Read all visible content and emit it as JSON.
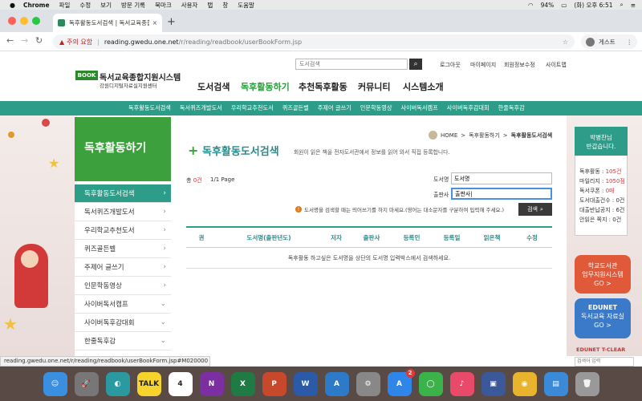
{
  "menubar": {
    "app": "Chrome",
    "items": [
      "파일",
      "수정",
      "보기",
      "방문 기록",
      "북마크",
      "사용자",
      "탭",
      "창",
      "도움말"
    ],
    "battery": "94%",
    "clock": "(화) 오후 6:51"
  },
  "tab": {
    "title": "독후활동도서검색 | 독서교육종합지원시스템",
    "close": "×"
  },
  "newtab": "+",
  "address": {
    "security": "주의 요함",
    "host": "reading.gwedu.one.net",
    "path": "/r/reading/readbook/userBookForm.jsp",
    "guest": "게스트"
  },
  "site": {
    "logo_badge": "BOOK",
    "logo_title": "독서교육종합지원시스템",
    "logo_sub": "강원디지털자료실지원센터",
    "search_placeholder": "도서검색",
    "util": [
      "로그아웃",
      "마이페이지",
      "회원정보수정",
      "사이트맵"
    ],
    "gnav": [
      "도서검색",
      "독후활동하기",
      "추천독후활동",
      "커뮤니티",
      "시스템소개"
    ],
    "subnav": [
      "독후활동도서검색",
      "독서퀴즈개발도서",
      "우리학교추천도서",
      "퀴즈골든벨",
      "주제어 글쓰기",
      "인문학동영상",
      "사이버독서캠프",
      "사이버독후감대회",
      "한줄독후감"
    ]
  },
  "side": {
    "title": "독후활동하기",
    "items": [
      "독후활동도서검색",
      "독서퀴즈개발도서",
      "우리학교추천도서",
      "퀴즈골든벨",
      "주제어 글쓰기",
      "인문학동영상",
      "사이버독서캠프",
      "사이버독후감대회",
      "한줄독후감"
    ]
  },
  "content": {
    "breadcrumb": [
      "HOME",
      ">",
      "독후활동하기",
      ">",
      "독후활동도서검색"
    ],
    "plus": "+",
    "title": "독후활동도서검색",
    "desc": "회원이 읽은 책을 전자도서관에서 정보를 읽어 와서 직접 등록합니다.",
    "count_label": "총",
    "count_value": "0건",
    "page": "1/1 Page",
    "book_label": "도서명",
    "book_value": "도서명",
    "pub_label": "출판사",
    "pub_value": "출판사|",
    "warning": "도서명을 검색할 때는 띄어쓰기를 하지 마세요.(영어는 대소문자를 구분하여 입력해 주세요.)",
    "search_btn": "검색",
    "columns": [
      "권",
      "도서명(출판년도)",
      "저자",
      "출판사",
      "등록인",
      "등록일",
      "읽은책",
      "수정"
    ],
    "empty_msg": "독후활동 하고싶은 도서명을 상단의 도서명 입력박스에서 검색하세요."
  },
  "user": {
    "greeting1": "박병찬님",
    "greeting2": "반갑습니다.",
    "stats": [
      {
        "label": "독후활동 : ",
        "value": "105건"
      },
      {
        "label": "마일리지 : ",
        "value": "1050점"
      },
      {
        "label": "독서쿠폰 : ",
        "value": "0매"
      },
      {
        "label": "도서대출건수 : ",
        "value": "0건"
      },
      {
        "label": "대출반납공지 : ",
        "value": "6건"
      },
      {
        "label": "안읽은 쪽지 : ",
        "value": "0건"
      }
    ]
  },
  "right": {
    "btn_a1": "학교도서관",
    "btn_a2": "업무지원시스템",
    "btn_a3": "GO >",
    "btn_b1": "EDUNET",
    "btn_b2": "독서교육 자료실",
    "btn_b3": "GO >",
    "edunet": "EDUNET T-CLEAR",
    "search_placeholder": "검색어 입력"
  },
  "status_url": "reading.gwedu.one.net/r/reading/readbook/userBookForm.jsp#M020000",
  "dock": [
    {
      "name": "finder",
      "color": "#3b8fe0",
      "label": "☺"
    },
    {
      "name": "launchpad",
      "color": "#777",
      "label": "🚀"
    },
    {
      "name": "safari-like",
      "color": "#2a9aa0",
      "label": "◐"
    },
    {
      "name": "kakaotalk",
      "color": "#f6d32d",
      "label": "TALK"
    },
    {
      "name": "calendar",
      "color": "#fff",
      "label": "4"
    },
    {
      "name": "onenote",
      "color": "#7b2fa0",
      "label": "N"
    },
    {
      "name": "excel",
      "color": "#1f7a44",
      "label": "X"
    },
    {
      "name": "powerpoint",
      "color": "#c8482b",
      "label": "P"
    },
    {
      "name": "word",
      "color": "#2b5ba8",
      "label": "W"
    },
    {
      "name": "dictionary",
      "color": "#2c7ac8",
      "label": "A"
    },
    {
      "name": "system-prefs",
      "color": "#888",
      "label": "⚙"
    },
    {
      "name": "app-store",
      "color": "#2d86e8",
      "label": "A"
    },
    {
      "name": "whatsapp",
      "color": "#3ab34a",
      "label": "◯"
    },
    {
      "name": "music",
      "color": "#e94a6a",
      "label": "♪"
    },
    {
      "name": "virtualbox",
      "color": "#3b5998",
      "label": "▣"
    },
    {
      "name": "chrome",
      "color": "#e8b32d",
      "label": "◉"
    },
    {
      "name": "docs",
      "color": "#3a8ad8",
      "label": "▤"
    },
    {
      "name": "trash",
      "color": "#999",
      "label": "🗑"
    }
  ],
  "dock_badge": "2"
}
